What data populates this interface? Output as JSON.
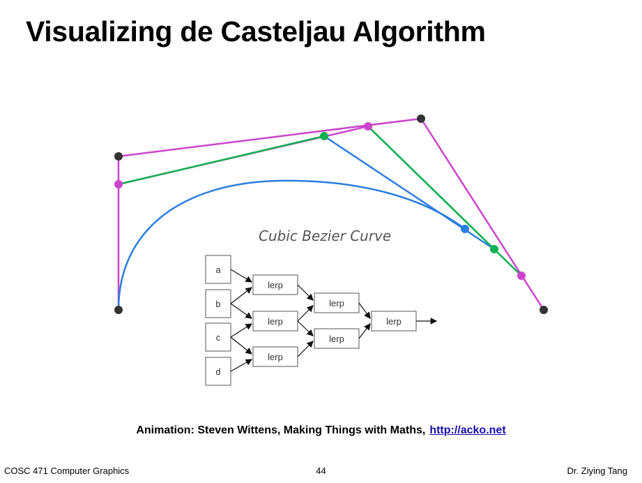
{
  "slide": {
    "title": "Visualizing de Casteljau Algorithm"
  },
  "diagram": {
    "curve_label": "Cubic Bezier Curve",
    "inputs": [
      "a",
      "b",
      "c",
      "d"
    ],
    "lerp_label": "lerp",
    "colors": {
      "control_polygon": "#cc44cc",
      "first_level": "#cc44cc",
      "second_level": "#11b050",
      "third_level": "#2a7de1",
      "curve": "#2a7de1",
      "control_points": "#333333"
    }
  },
  "credit": {
    "text": "Animation: Steven Wittens, Making Things with Maths,",
    "link_text": "http://acko.net"
  },
  "footer": {
    "course": "COSC 471 Computer Graphics",
    "page": "44",
    "author": "Dr. Ziying Tang"
  }
}
